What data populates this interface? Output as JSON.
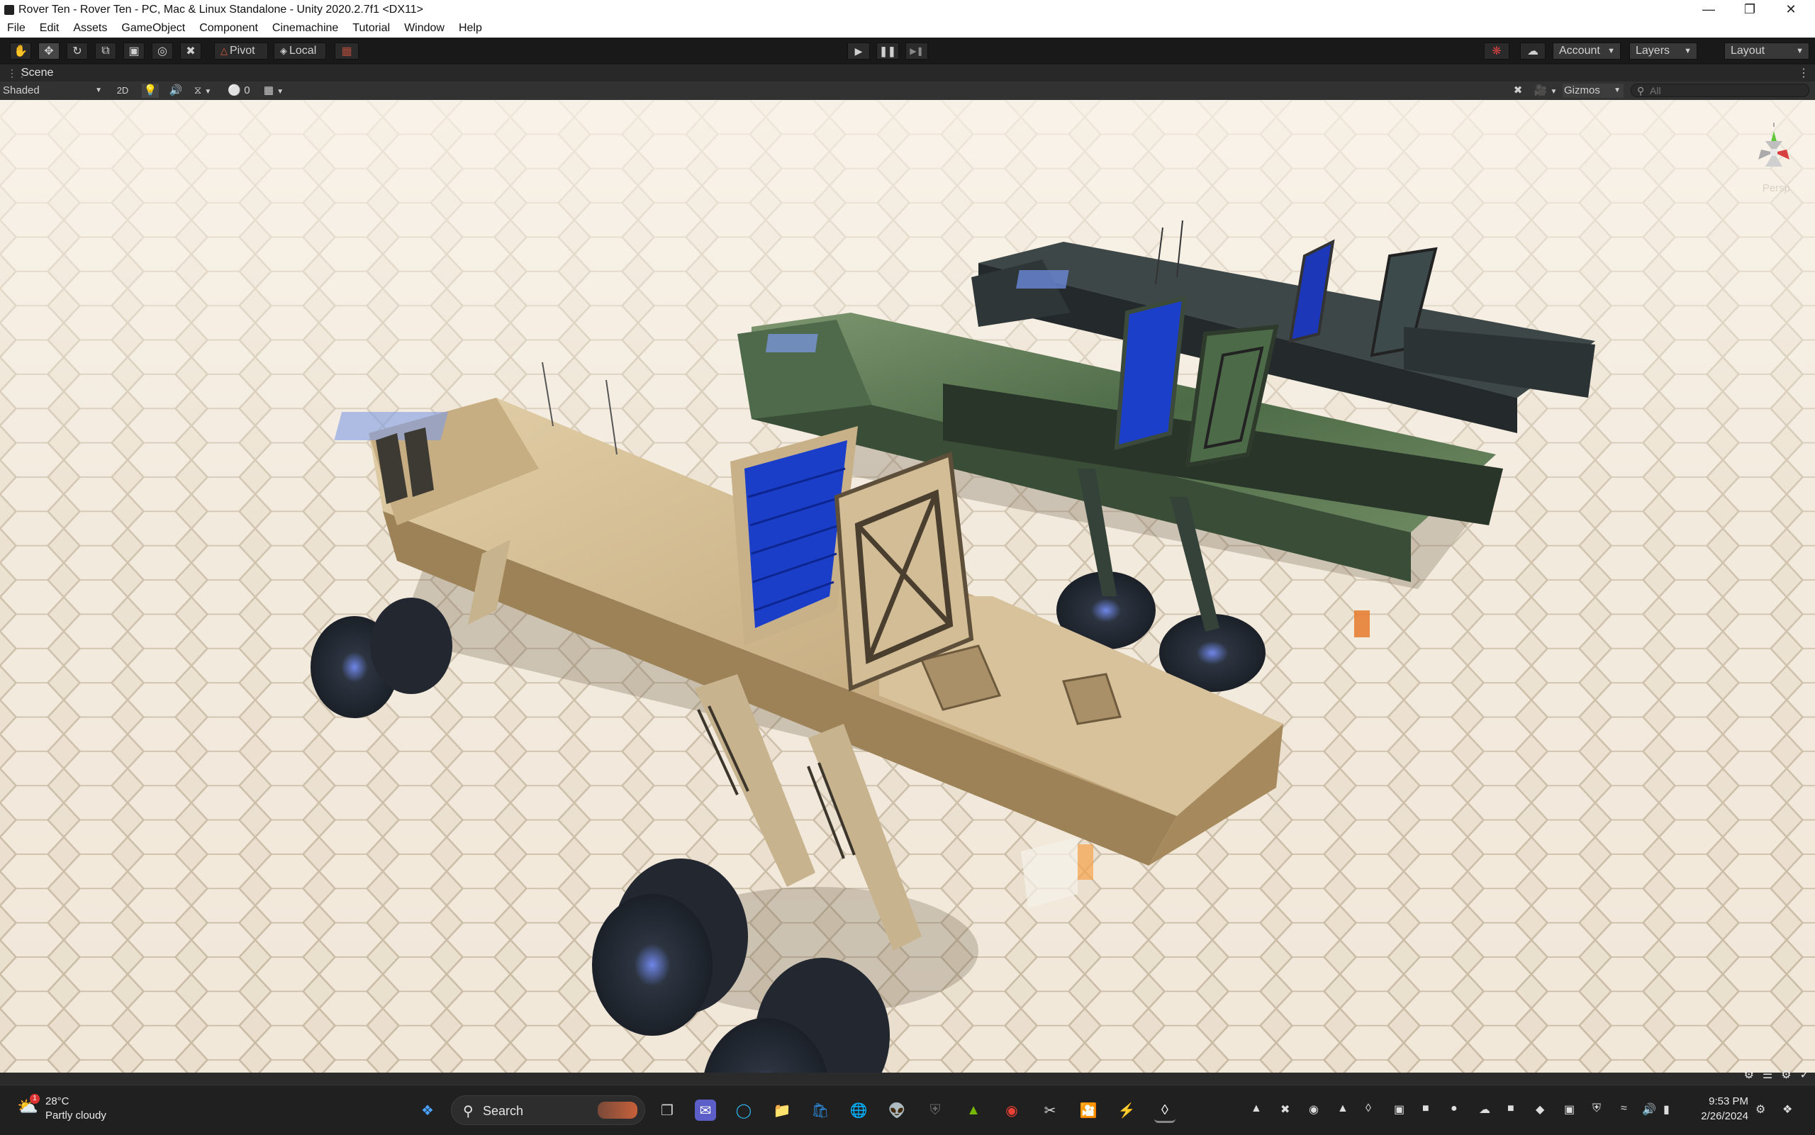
{
  "window": {
    "title": "Rover Ten - Rover Ten - PC, Mac & Linux Standalone - Unity 2020.2.7f1 <DX11>",
    "minimize_icon": "minimize-icon",
    "maximize_icon": "restore-icon",
    "close_icon": "close-icon"
  },
  "menu": {
    "items": [
      "File",
      "Edit",
      "Assets",
      "GameObject",
      "Component",
      "Cinemachine",
      "Tutorial",
      "Window",
      "Help"
    ]
  },
  "toolbar": {
    "tools": [
      "hand-icon",
      "move-icon",
      "rotate-icon",
      "scale-icon",
      "rect-icon",
      "transform-icon",
      "custom-tool-icon"
    ],
    "pivot_label": "Pivot",
    "local_label": "Local",
    "play_icon": "play-icon",
    "pause_icon": "pause-icon",
    "step_icon": "step-icon",
    "account_label": "Account",
    "layers_label": "Layers",
    "layout_label": "Layout"
  },
  "scene_tab": {
    "label": "Scene"
  },
  "scene_toolbar": {
    "draw_mode": "Shaded",
    "mode_2d": "2D",
    "hidden_count": "0",
    "gizmos_label": "Gizmos",
    "search_placeholder": "All"
  },
  "viewport": {
    "projection_label": "Persp"
  },
  "taskbar": {
    "weather_temp": "28°C",
    "weather_cond": "Partly cloudy",
    "weather_badge": "1",
    "search_label": "Search",
    "time": "9:53 PM",
    "date": "2/26/2024"
  },
  "colors": {
    "toolbar_bg": "#191919",
    "scene_bg": "#ece2d2",
    "rover_sand": "#cdb48a",
    "rover_camo": "#5d7a52",
    "solar_blue": "#1a3ec8"
  }
}
